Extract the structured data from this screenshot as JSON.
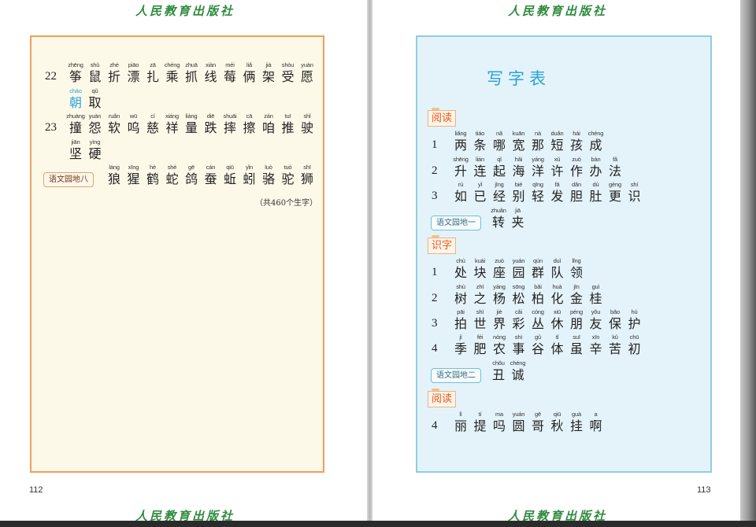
{
  "publisher": "人民教育出版社",
  "left_page": {
    "page_number": "112",
    "rows": [
      {
        "num": "22",
        "chars": [
          {
            "py": "zhēng",
            "hz": "筝"
          },
          {
            "py": "shǔ",
            "hz": "鼠"
          },
          {
            "py": "zhé",
            "hz": "折"
          },
          {
            "py": "piāo",
            "hz": "漂"
          },
          {
            "py": "zā",
            "hz": "扎"
          },
          {
            "py": "chéng",
            "hz": "乘"
          },
          {
            "py": "zhuā",
            "hz": "抓"
          },
          {
            "py": "xiàn",
            "hz": "线"
          },
          {
            "py": "méi",
            "hz": "莓"
          },
          {
            "py": "liǎ",
            "hz": "俩"
          },
          {
            "py": "jià",
            "hz": "架"
          },
          {
            "py": "shòu",
            "hz": "受"
          },
          {
            "py": "yuàn",
            "hz": "愿"
          }
        ]
      },
      {
        "num": "",
        "chars": [
          {
            "py": "cháo",
            "hz": "朝",
            "hl": true
          },
          {
            "py": "qǔ",
            "hz": "取"
          }
        ]
      },
      {
        "num": "23",
        "chars": [
          {
            "py": "zhuàng",
            "hz": "撞"
          },
          {
            "py": "yuàn",
            "hz": "怨"
          },
          {
            "py": "ruǎn",
            "hz": "软"
          },
          {
            "py": "wū",
            "hz": "呜"
          },
          {
            "py": "cí",
            "hz": "慈"
          },
          {
            "py": "xiáng",
            "hz": "祥"
          },
          {
            "py": "liàng",
            "hz": "量"
          },
          {
            "py": "diē",
            "hz": "跌"
          },
          {
            "py": "shuāi",
            "hz": "摔"
          },
          {
            "py": "cā",
            "hz": "擦"
          },
          {
            "py": "zán",
            "hz": "咱"
          },
          {
            "py": "tuī",
            "hz": "推"
          },
          {
            "py": "shǐ",
            "hz": "驶"
          }
        ]
      },
      {
        "num": "",
        "chars": [
          {
            "py": "jiān",
            "hz": "坚"
          },
          {
            "py": "yìng",
            "hz": "硬"
          }
        ]
      },
      {
        "num": "",
        "tag": "语文园地八",
        "chars": [
          {
            "py": "láng",
            "hz": "狼"
          },
          {
            "py": "xīng",
            "hz": "猩"
          },
          {
            "py": "hè",
            "hz": "鹤"
          },
          {
            "py": "shé",
            "hz": "蛇"
          },
          {
            "py": "gē",
            "hz": "鸽"
          },
          {
            "py": "cán",
            "hz": "蚕"
          },
          {
            "py": "qiū",
            "hz": "蚯"
          },
          {
            "py": "yǐn",
            "hz": "蚓"
          },
          {
            "py": "luò",
            "hz": "骆"
          },
          {
            "py": "tuó",
            "hz": "驼"
          },
          {
            "py": "shī",
            "hz": "狮"
          }
        ]
      }
    ],
    "total": "（共460个生字）"
  },
  "right_page": {
    "page_number": "113",
    "title": "写字表",
    "sections": [
      {
        "label": "阅读",
        "rows": [
          {
            "num": "1",
            "chars": [
              {
                "py": "liǎng",
                "hz": "两"
              },
              {
                "py": "tiáo",
                "hz": "条"
              },
              {
                "py": "nǎ",
                "hz": "哪"
              },
              {
                "py": "kuān",
                "hz": "宽"
              },
              {
                "py": "nà",
                "hz": "那"
              },
              {
                "py": "duǎn",
                "hz": "短"
              },
              {
                "py": "hái",
                "hz": "孩"
              },
              {
                "py": "chéng",
                "hz": "成"
              }
            ]
          },
          {
            "num": "2",
            "chars": [
              {
                "py": "shēng",
                "hz": "升"
              },
              {
                "py": "lián",
                "hz": "连"
              },
              {
                "py": "qǐ",
                "hz": "起"
              },
              {
                "py": "hǎi",
                "hz": "海"
              },
              {
                "py": "yáng",
                "hz": "洋"
              },
              {
                "py": "xǔ",
                "hz": "许"
              },
              {
                "py": "zuò",
                "hz": "作"
              },
              {
                "py": "bàn",
                "hz": "办"
              },
              {
                "py": "fǎ",
                "hz": "法"
              }
            ]
          },
          {
            "num": "3",
            "chars": [
              {
                "py": "rú",
                "hz": "如"
              },
              {
                "py": "yǐ",
                "hz": "已"
              },
              {
                "py": "jīng",
                "hz": "经"
              },
              {
                "py": "bié",
                "hz": "别"
              },
              {
                "py": "qīng",
                "hz": "轻"
              },
              {
                "py": "fā",
                "hz": "发"
              },
              {
                "py": "dǎn",
                "hz": "胆"
              },
              {
                "py": "dù",
                "hz": "肚"
              },
              {
                "py": "gèng",
                "hz": "更"
              },
              {
                "py": "shí",
                "hz": "识"
              }
            ]
          },
          {
            "num": "",
            "tag": "语文园地一",
            "chars": [
              {
                "py": "zhuǎn",
                "hz": "转"
              },
              {
                "py": "jiā",
                "hz": "夹"
              }
            ]
          }
        ]
      },
      {
        "label": "识字",
        "rows": [
          {
            "num": "1",
            "chars": [
              {
                "py": "chù",
                "hz": "处"
              },
              {
                "py": "kuài",
                "hz": "块"
              },
              {
                "py": "zuò",
                "hz": "座"
              },
              {
                "py": "yuán",
                "hz": "园"
              },
              {
                "py": "qún",
                "hz": "群"
              },
              {
                "py": "duì",
                "hz": "队"
              },
              {
                "py": "lǐng",
                "hz": "领"
              }
            ]
          },
          {
            "num": "2",
            "chars": [
              {
                "py": "shù",
                "hz": "树"
              },
              {
                "py": "zhī",
                "hz": "之"
              },
              {
                "py": "yáng",
                "hz": "杨"
              },
              {
                "py": "sōng",
                "hz": "松"
              },
              {
                "py": "bǎi",
                "hz": "柏"
              },
              {
                "py": "huà",
                "hz": "化"
              },
              {
                "py": "jīn",
                "hz": "金"
              },
              {
                "py": "guì",
                "hz": "桂"
              }
            ]
          },
          {
            "num": "3",
            "chars": [
              {
                "py": "pāi",
                "hz": "拍"
              },
              {
                "py": "shì",
                "hz": "世"
              },
              {
                "py": "jiè",
                "hz": "界"
              },
              {
                "py": "cǎi",
                "hz": "彩"
              },
              {
                "py": "cóng",
                "hz": "丛"
              },
              {
                "py": "xiū",
                "hz": "休"
              },
              {
                "py": "péng",
                "hz": "朋"
              },
              {
                "py": "yǒu",
                "hz": "友"
              },
              {
                "py": "bǎo",
                "hz": "保"
              },
              {
                "py": "hù",
                "hz": "护"
              }
            ]
          },
          {
            "num": "4",
            "chars": [
              {
                "py": "jì",
                "hz": "季"
              },
              {
                "py": "féi",
                "hz": "肥"
              },
              {
                "py": "nóng",
                "hz": "农"
              },
              {
                "py": "shì",
                "hz": "事"
              },
              {
                "py": "gǔ",
                "hz": "谷"
              },
              {
                "py": "tǐ",
                "hz": "体"
              },
              {
                "py": "suī",
                "hz": "虽"
              },
              {
                "py": "xīn",
                "hz": "辛"
              },
              {
                "py": "kǔ",
                "hz": "苦"
              },
              {
                "py": "chū",
                "hz": "初"
              }
            ]
          },
          {
            "num": "",
            "tag": "语文园地二",
            "chars": [
              {
                "py": "chǒu",
                "hz": "丑"
              },
              {
                "py": "chéng",
                "hz": "诚"
              }
            ]
          }
        ]
      },
      {
        "label": "阅读",
        "rows": [
          {
            "num": "4",
            "chars": [
              {
                "py": "lì",
                "hz": "丽"
              },
              {
                "py": "tí",
                "hz": "提"
              },
              {
                "py": "ma",
                "hz": "吗"
              },
              {
                "py": "yuán",
                "hz": "圆"
              },
              {
                "py": "gē",
                "hz": "哥"
              },
              {
                "py": "qiū",
                "hz": "秋"
              },
              {
                "py": "guà",
                "hz": "挂"
              },
              {
                "py": "a",
                "hz": "啊"
              }
            ]
          }
        ]
      }
    ]
  }
}
